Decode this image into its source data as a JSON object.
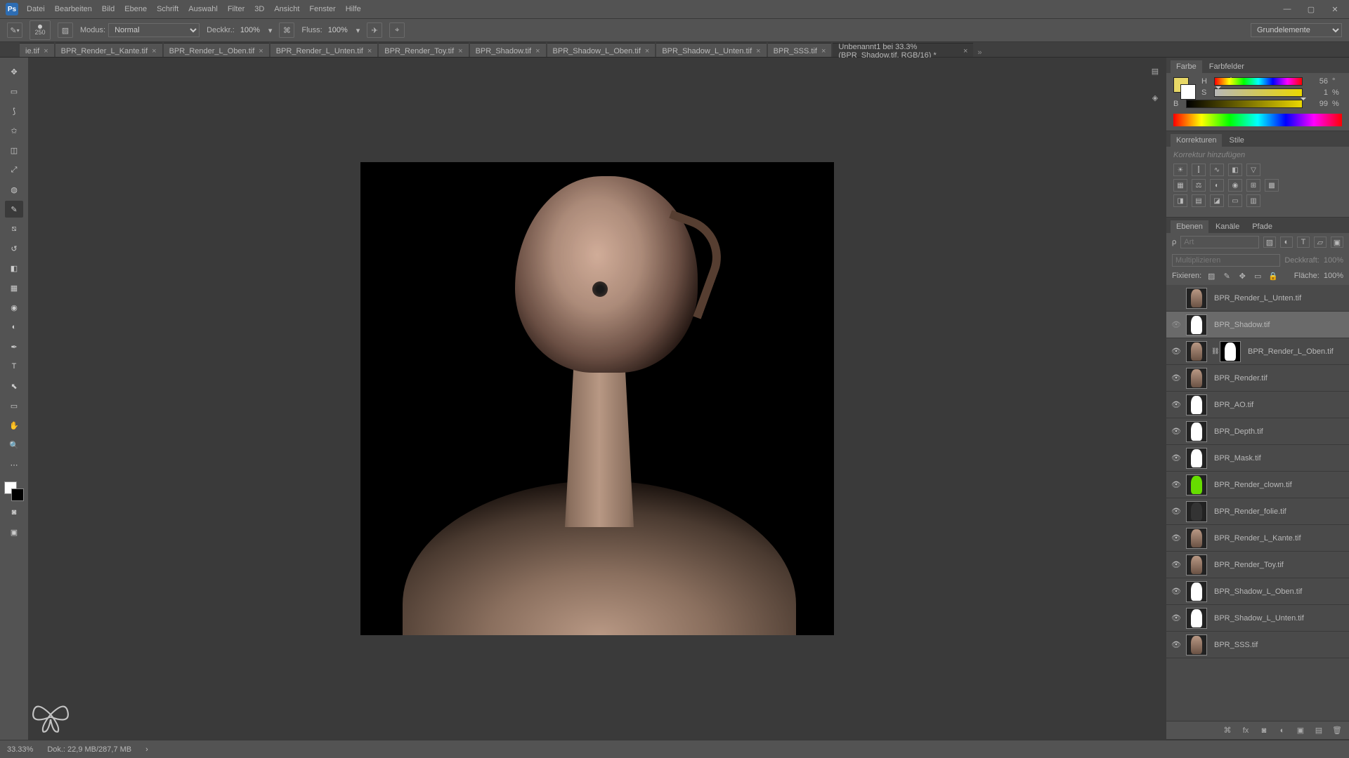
{
  "menu": [
    "Datei",
    "Bearbeiten",
    "Bild",
    "Ebene",
    "Schrift",
    "Auswahl",
    "Filter",
    "3D",
    "Ansicht",
    "Fenster",
    "Hilfe"
  ],
  "app_logo": "Ps",
  "optbar": {
    "brush_size": "250",
    "modus_label": "Modus:",
    "modus_value": "Normal",
    "deckkr_label": "Deckkr.:",
    "deckkr_value": "100%",
    "fluss_label": "Fluss:",
    "fluss_value": "100%",
    "grund_label": "Grundelemente"
  },
  "tabs": [
    {
      "label": "ie.tif",
      "active": false
    },
    {
      "label": "BPR_Render_L_Kante.tif",
      "active": false
    },
    {
      "label": "BPR_Render_L_Oben.tif",
      "active": false
    },
    {
      "label": "BPR_Render_L_Unten.tif",
      "active": false
    },
    {
      "label": "BPR_Render_Toy.tif",
      "active": false
    },
    {
      "label": "BPR_Shadow.tif",
      "active": false
    },
    {
      "label": "BPR_Shadow_L_Oben.tif",
      "active": false
    },
    {
      "label": "BPR_Shadow_L_Unten.tif",
      "active": false
    },
    {
      "label": "BPR_SSS.tif",
      "active": false
    },
    {
      "label": "Unbenannt1 bei 33.3% (BPR_Shadow.tif, RGB/16) *",
      "active": true
    }
  ],
  "color_panel": {
    "tab_farbe": "Farbe",
    "tab_farbfelder": "Farbfelder",
    "h_label": "H",
    "h_val": "56",
    "h_unit": "°",
    "s_label": "S",
    "s_val": "1",
    "s_unit": "%",
    "b_label": "B",
    "b_val": "99",
    "b_unit": "%"
  },
  "adj_panel": {
    "tab_korrekturen": "Korrekturen",
    "tab_stile": "Stile",
    "hint": "Korrektur hinzufügen"
  },
  "layer_panel": {
    "tab_ebenen": "Ebenen",
    "tab_kanale": "Kanäle",
    "tab_pfade": "Pfade",
    "filter_label": "Art",
    "blend_mode": "Multiplizieren",
    "deckkr_label": "Deckkraft:",
    "deckkr_val": "100%",
    "fix_label": "Fixieren:",
    "flache_label": "Fläche:",
    "flache_val": "100%"
  },
  "layers": [
    {
      "name": "BPR_Render_L_Unten.tif",
      "visible": false,
      "selected": false,
      "thumb": "normal",
      "mask": null
    },
    {
      "name": "BPR_Shadow.tif",
      "visible": false,
      "selected": true,
      "thumb": "white",
      "mask": null,
      "hover_eye": true
    },
    {
      "name": "BPR_Render_L_Oben.tif",
      "visible": true,
      "selected": false,
      "thumb": "normal",
      "mask": "maskblack",
      "linked": true
    },
    {
      "name": "BPR_Render.tif",
      "visible": true,
      "selected": false,
      "thumb": "normal",
      "mask": null
    },
    {
      "name": "BPR_AO.tif",
      "visible": true,
      "selected": false,
      "thumb": "white",
      "mask": null
    },
    {
      "name": "BPR_Depth.tif",
      "visible": true,
      "selected": false,
      "thumb": "white",
      "mask": null
    },
    {
      "name": "BPR_Mask.tif",
      "visible": true,
      "selected": false,
      "thumb": "white",
      "mask": null
    },
    {
      "name": "BPR_Render_clown.tif",
      "visible": true,
      "selected": false,
      "thumb": "green",
      "mask": null
    },
    {
      "name": "BPR_Render_folie.tif",
      "visible": true,
      "selected": false,
      "thumb": "dark",
      "mask": null
    },
    {
      "name": "BPR_Render_L_Kante.tif",
      "visible": true,
      "selected": false,
      "thumb": "normal",
      "mask": null
    },
    {
      "name": "BPR_Render_Toy.tif",
      "visible": true,
      "selected": false,
      "thumb": "normal",
      "mask": null
    },
    {
      "name": "BPR_Shadow_L_Oben.tif",
      "visible": true,
      "selected": false,
      "thumb": "white",
      "mask": null
    },
    {
      "name": "BPR_Shadow_L_Unten.tif",
      "visible": true,
      "selected": false,
      "thumb": "white",
      "mask": null
    },
    {
      "name": "BPR_SSS.tif",
      "visible": true,
      "selected": false,
      "thumb": "normal",
      "mask": null
    }
  ],
  "status": {
    "zoom": "33.33%",
    "dok": "Dok.: 22,9 MB/287,7 MB"
  }
}
